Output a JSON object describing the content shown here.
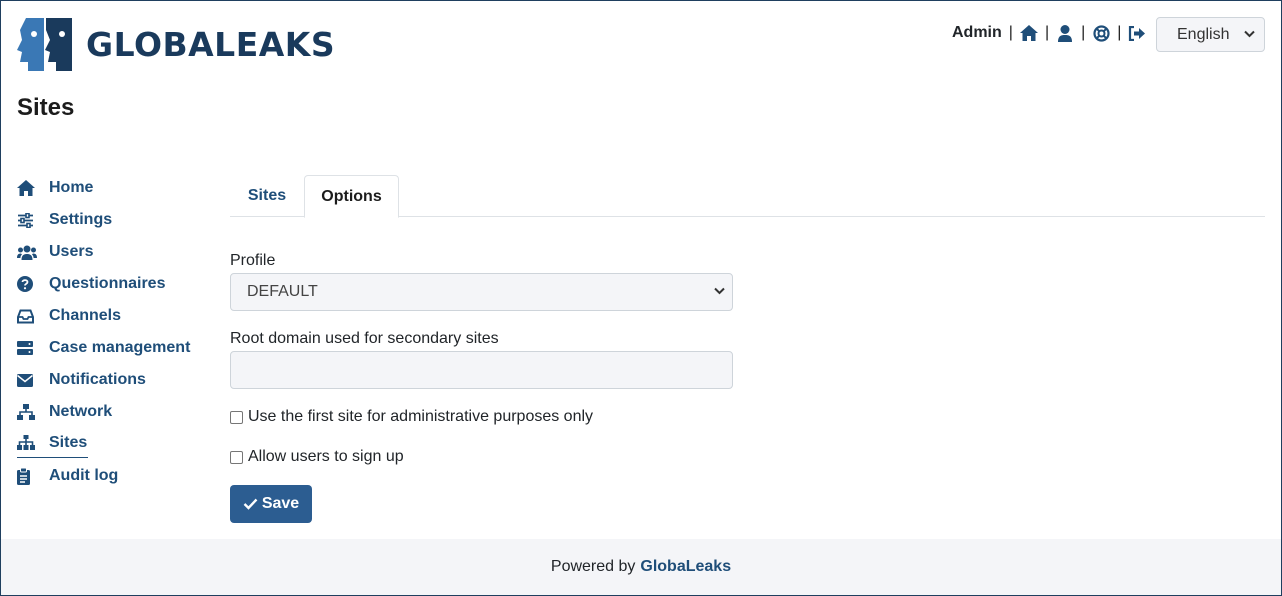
{
  "header": {
    "logo_text": "GLOBALEAKS",
    "user_label": "Admin",
    "separator": "|",
    "icons": [
      "home-icon",
      "user-icon",
      "lifebuoy-icon",
      "logout-icon"
    ],
    "language": "English"
  },
  "page": {
    "title": "Sites"
  },
  "sidebar": {
    "items": [
      {
        "label": "Home",
        "icon": "home-icon"
      },
      {
        "label": "Settings",
        "icon": "sliders-icon"
      },
      {
        "label": "Users",
        "icon": "users-icon"
      },
      {
        "label": "Questionnaires",
        "icon": "question-circle-icon"
      },
      {
        "label": "Channels",
        "icon": "inbox-icon"
      },
      {
        "label": "Case management",
        "icon": "server-icon"
      },
      {
        "label": "Notifications",
        "icon": "envelope-icon"
      },
      {
        "label": "Network",
        "icon": "network-icon"
      },
      {
        "label": "Sites",
        "icon": "sitemap-icon",
        "active": true
      },
      {
        "label": "Audit log",
        "icon": "clipboard-icon"
      }
    ]
  },
  "tabs": [
    {
      "label": "Sites",
      "active": false
    },
    {
      "label": "Options",
      "active": true
    }
  ],
  "form": {
    "profile_label": "Profile",
    "profile_value": "DEFAULT",
    "root_domain_label": "Root domain used for secondary sites",
    "root_domain_value": "",
    "checkbox_first_site": "Use the first site for administrative purposes only",
    "checkbox_signup": "Allow users to sign up",
    "save_label": "Save"
  },
  "footer": {
    "prefix": "Powered by",
    "brand": "GlobaLeaks"
  },
  "colors": {
    "primary": "#1f4e79",
    "button": "#2c5d91",
    "logo": "#1a3a5c",
    "logo_accent": "#3a78b5"
  }
}
